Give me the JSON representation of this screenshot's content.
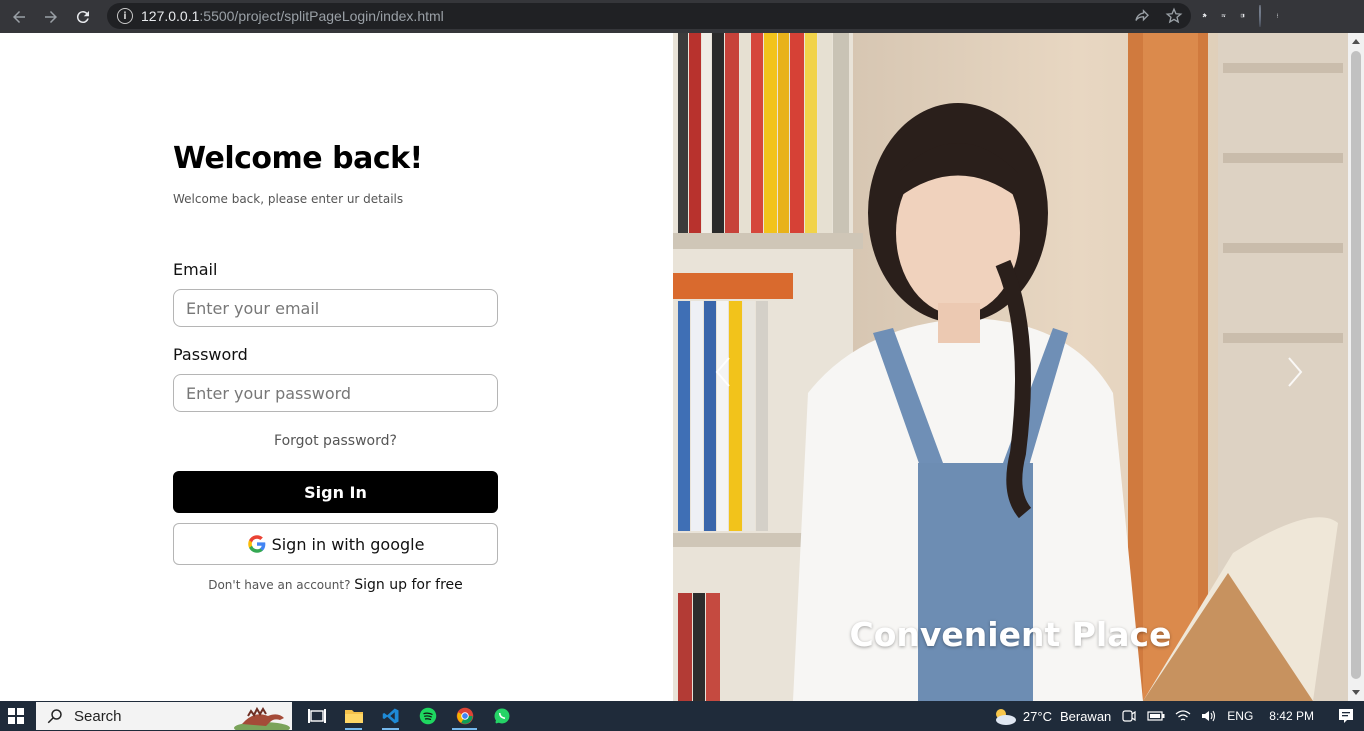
{
  "browser": {
    "url_host": "127.0.0.1",
    "url_rest": ":5500/project/splitPageLogin/index.html"
  },
  "login": {
    "title": "Welcome back!",
    "subtitle": "Welcome back, please enter ur details",
    "email_label": "Email",
    "email_placeholder": "Enter your email",
    "password_label": "Password",
    "password_placeholder": "Enter your password",
    "forgot_label": "Forgot password?",
    "signin_label": "Sign In",
    "google_label": "Sign in with google",
    "no_account_text": "Don't have an account?",
    "signup_label": "Sign up for free"
  },
  "carousel": {
    "caption": "Convenient Place"
  },
  "taskbar": {
    "search_label": "Search",
    "weather_temp": "27°C",
    "weather_desc": "Berawan",
    "language": "ENG",
    "time": "8:42 PM"
  },
  "colors": {
    "chrome_bar": "#35363a",
    "omnibox": "#202124",
    "signin_button": "#000000",
    "taskbar": "#1f2b3a"
  }
}
